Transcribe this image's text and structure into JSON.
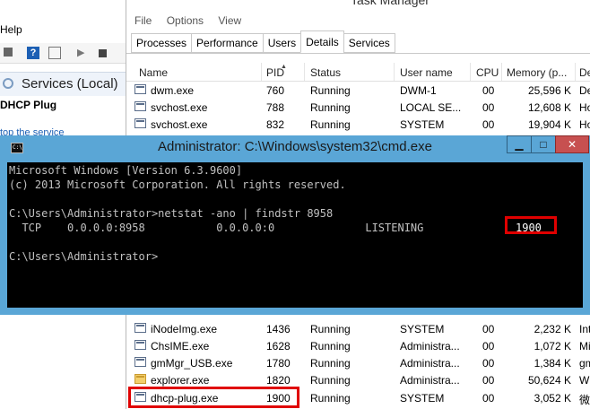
{
  "services": {
    "menu_help": "Help",
    "title": "Services (Local)",
    "service_name": "DHCP Plug",
    "link_fragment": "top the service"
  },
  "taskmgr": {
    "title": "Task Manager",
    "menu": [
      "File",
      "Options",
      "View"
    ],
    "tabs": [
      "Processes",
      "Performance",
      "Users",
      "Details",
      "Services"
    ],
    "active_tab": "Details",
    "columns": [
      "Name",
      "PID",
      "Status",
      "User name",
      "CPU",
      "Memory (p...",
      "De"
    ],
    "rows_top": [
      {
        "name": "dwm.exe",
        "pid": "760",
        "status": "Running",
        "user": "DWM-1",
        "cpu": "00",
        "mem": "25,596 K",
        "desc": "De"
      },
      {
        "name": "svchost.exe",
        "pid": "788",
        "status": "Running",
        "user": "LOCAL SE...",
        "cpu": "00",
        "mem": "12,608 K",
        "desc": "Ho"
      },
      {
        "name": "svchost.exe",
        "pid": "832",
        "status": "Running",
        "user": "SYSTEM",
        "cpu": "00",
        "mem": "19,904 K",
        "desc": "Ho"
      }
    ],
    "rows_bottom": [
      {
        "name": "iNodeImg.exe",
        "pid": "1436",
        "status": "Running",
        "user": "SYSTEM",
        "cpu": "00",
        "mem": "2,232 K",
        "desc": "Int"
      },
      {
        "name": "ChsIME.exe",
        "pid": "1628",
        "status": "Running",
        "user": "Administra...",
        "cpu": "00",
        "mem": "1,072 K",
        "desc": "Mi"
      },
      {
        "name": "gmMgr_USB.exe",
        "pid": "1780",
        "status": "Running",
        "user": "Administra...",
        "cpu": "00",
        "mem": "1,384 K",
        "desc": "gm"
      },
      {
        "name": "explorer.exe",
        "pid": "1820",
        "status": "Running",
        "user": "Administra...",
        "cpu": "00",
        "mem": "50,624 K",
        "desc": "Wi"
      },
      {
        "name": "dhcp-plug.exe",
        "pid": "1900",
        "status": "Running",
        "user": "SYSTEM",
        "cpu": "00",
        "mem": "3,052 K",
        "desc": "微"
      }
    ]
  },
  "cmd": {
    "title": "Administrator: C:\\Windows\\system32\\cmd.exe",
    "btn_min": "▁",
    "btn_max": "□",
    "btn_close": "✕",
    "lines": [
      "Microsoft Windows [Version 6.3.9600]",
      "(c) 2013 Microsoft Corporation. All rights reserved.",
      "",
      "C:\\Users\\Administrator>netstat -ano | findstr 8958",
      "  TCP    0.0.0.0:8958           0.0.0.0:0              LISTENING",
      "",
      "C:\\Users\\Administrator>"
    ],
    "pid": "1900"
  },
  "colors": {
    "cmd_frame": "#5aa6d6",
    "highlight": "#e00000",
    "console_bg": "#000000",
    "console_fg": "#c0c0c0"
  }
}
